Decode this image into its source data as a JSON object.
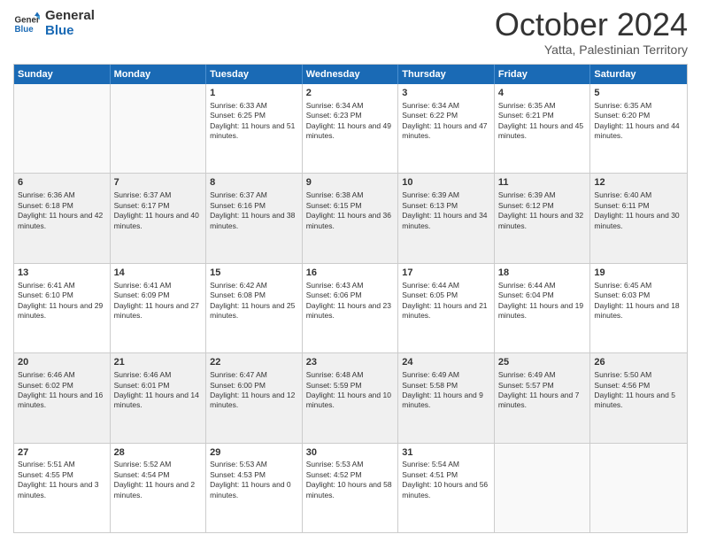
{
  "logo": {
    "line1": "General",
    "line2": "Blue"
  },
  "header": {
    "month": "October 2024",
    "location": "Yatta, Palestinian Territory"
  },
  "days": [
    "Sunday",
    "Monday",
    "Tuesday",
    "Wednesday",
    "Thursday",
    "Friday",
    "Saturday"
  ],
  "rows": [
    [
      {
        "day": "",
        "info": ""
      },
      {
        "day": "",
        "info": ""
      },
      {
        "day": "1",
        "info": "Sunrise: 6:33 AM\nSunset: 6:25 PM\nDaylight: 11 hours and 51 minutes."
      },
      {
        "day": "2",
        "info": "Sunrise: 6:34 AM\nSunset: 6:23 PM\nDaylight: 11 hours and 49 minutes."
      },
      {
        "day": "3",
        "info": "Sunrise: 6:34 AM\nSunset: 6:22 PM\nDaylight: 11 hours and 47 minutes."
      },
      {
        "day": "4",
        "info": "Sunrise: 6:35 AM\nSunset: 6:21 PM\nDaylight: 11 hours and 45 minutes."
      },
      {
        "day": "5",
        "info": "Sunrise: 6:35 AM\nSunset: 6:20 PM\nDaylight: 11 hours and 44 minutes."
      }
    ],
    [
      {
        "day": "6",
        "info": "Sunrise: 6:36 AM\nSunset: 6:18 PM\nDaylight: 11 hours and 42 minutes."
      },
      {
        "day": "7",
        "info": "Sunrise: 6:37 AM\nSunset: 6:17 PM\nDaylight: 11 hours and 40 minutes."
      },
      {
        "day": "8",
        "info": "Sunrise: 6:37 AM\nSunset: 6:16 PM\nDaylight: 11 hours and 38 minutes."
      },
      {
        "day": "9",
        "info": "Sunrise: 6:38 AM\nSunset: 6:15 PM\nDaylight: 11 hours and 36 minutes."
      },
      {
        "day": "10",
        "info": "Sunrise: 6:39 AM\nSunset: 6:13 PM\nDaylight: 11 hours and 34 minutes."
      },
      {
        "day": "11",
        "info": "Sunrise: 6:39 AM\nSunset: 6:12 PM\nDaylight: 11 hours and 32 minutes."
      },
      {
        "day": "12",
        "info": "Sunrise: 6:40 AM\nSunset: 6:11 PM\nDaylight: 11 hours and 30 minutes."
      }
    ],
    [
      {
        "day": "13",
        "info": "Sunrise: 6:41 AM\nSunset: 6:10 PM\nDaylight: 11 hours and 29 minutes."
      },
      {
        "day": "14",
        "info": "Sunrise: 6:41 AM\nSunset: 6:09 PM\nDaylight: 11 hours and 27 minutes."
      },
      {
        "day": "15",
        "info": "Sunrise: 6:42 AM\nSunset: 6:08 PM\nDaylight: 11 hours and 25 minutes."
      },
      {
        "day": "16",
        "info": "Sunrise: 6:43 AM\nSunset: 6:06 PM\nDaylight: 11 hours and 23 minutes."
      },
      {
        "day": "17",
        "info": "Sunrise: 6:44 AM\nSunset: 6:05 PM\nDaylight: 11 hours and 21 minutes."
      },
      {
        "day": "18",
        "info": "Sunrise: 6:44 AM\nSunset: 6:04 PM\nDaylight: 11 hours and 19 minutes."
      },
      {
        "day": "19",
        "info": "Sunrise: 6:45 AM\nSunset: 6:03 PM\nDaylight: 11 hours and 18 minutes."
      }
    ],
    [
      {
        "day": "20",
        "info": "Sunrise: 6:46 AM\nSunset: 6:02 PM\nDaylight: 11 hours and 16 minutes."
      },
      {
        "day": "21",
        "info": "Sunrise: 6:46 AM\nSunset: 6:01 PM\nDaylight: 11 hours and 14 minutes."
      },
      {
        "day": "22",
        "info": "Sunrise: 6:47 AM\nSunset: 6:00 PM\nDaylight: 11 hours and 12 minutes."
      },
      {
        "day": "23",
        "info": "Sunrise: 6:48 AM\nSunset: 5:59 PM\nDaylight: 11 hours and 10 minutes."
      },
      {
        "day": "24",
        "info": "Sunrise: 6:49 AM\nSunset: 5:58 PM\nDaylight: 11 hours and 9 minutes."
      },
      {
        "day": "25",
        "info": "Sunrise: 6:49 AM\nSunset: 5:57 PM\nDaylight: 11 hours and 7 minutes."
      },
      {
        "day": "26",
        "info": "Sunrise: 5:50 AM\nSunset: 4:56 PM\nDaylight: 11 hours and 5 minutes."
      }
    ],
    [
      {
        "day": "27",
        "info": "Sunrise: 5:51 AM\nSunset: 4:55 PM\nDaylight: 11 hours and 3 minutes."
      },
      {
        "day": "28",
        "info": "Sunrise: 5:52 AM\nSunset: 4:54 PM\nDaylight: 11 hours and 2 minutes."
      },
      {
        "day": "29",
        "info": "Sunrise: 5:53 AM\nSunset: 4:53 PM\nDaylight: 11 hours and 0 minutes."
      },
      {
        "day": "30",
        "info": "Sunrise: 5:53 AM\nSunset: 4:52 PM\nDaylight: 10 hours and 58 minutes."
      },
      {
        "day": "31",
        "info": "Sunrise: 5:54 AM\nSunset: 4:51 PM\nDaylight: 10 hours and 56 minutes."
      },
      {
        "day": "",
        "info": ""
      },
      {
        "day": "",
        "info": ""
      }
    ]
  ]
}
